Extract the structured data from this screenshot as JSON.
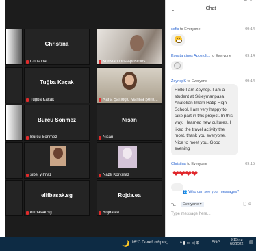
{
  "tiles": [
    {
      "center": "Christina",
      "label": "Christina"
    },
    {
      "center": "",
      "label": "Konstantinos Apostolos..."
    },
    {
      "center": "Tuğba Kaçak",
      "label": "Tuğba Kaçak"
    },
    {
      "center": "",
      "label": "Rana Şaltıoğlu Manisa Şehit..."
    },
    {
      "center": "Burcu Sonmez",
      "label": "Burcu Sonmez"
    },
    {
      "center": "Nisan",
      "label": "Nisan"
    },
    {
      "center": "",
      "label": "sibel yılmaz"
    },
    {
      "center": "",
      "label": "Nazlı Korkmaz"
    },
    {
      "center": "elifbasak.sg",
      "label": "elifbasak.sg"
    },
    {
      "center": "Rojda.ea",
      "label": "Rojda.ea"
    }
  ],
  "chat": {
    "title": "Chat",
    "messages": [
      {
        "sender": "sofia",
        "to": "to Everyone",
        "time": "09:14"
      },
      {
        "sender": "Konstantinos Apostoli...",
        "to": "to Everyone",
        "time": "09:14"
      },
      {
        "sender": "ZeynepK",
        "to": "to Everyone",
        "time": "09:14",
        "text": "Hello I am Zeynep. I am a student at Süleymanpasa Anatolian Imam Hatip High School. I am very happy to take part in this project. In this way, I learned new cultures. I liked the travel activity the most. thank you everyone. Nice to meet you. Good evening"
      },
      {
        "sender": "Christina",
        "to": "to Everyone",
        "time": "09:15"
      }
    ],
    "who_can_see": "Who can see your messages?",
    "to_label": "To:",
    "recipient": "Everyone",
    "input_placeholder": "Type message here..."
  },
  "taskbar": {
    "weather": "16°C Γενικά αίθριος",
    "lang": "ENG",
    "time": "9:15 πμ",
    "date": "6/3/2022"
  }
}
